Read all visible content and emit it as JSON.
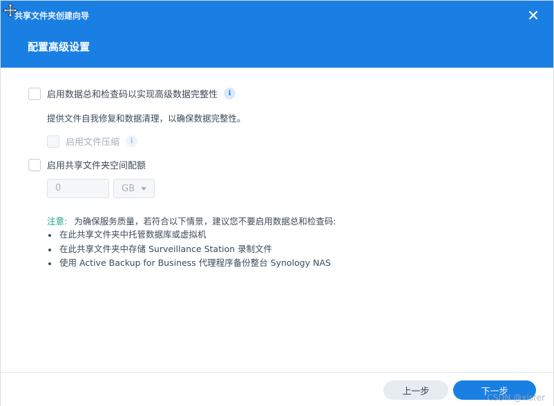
{
  "window": {
    "title": "共享文件夹创建向导",
    "step_title": "配置高级设置",
    "close_icon": "close-icon",
    "move_icon": "move-icon"
  },
  "options": {
    "checksum": {
      "label": "启用数据总和检查码以实现高级数据完整性",
      "checked": false
    },
    "checksum_desc": "提供文件自我修复和数据清理，以确保数据完整性。",
    "compression": {
      "label": "启用文件压缩",
      "checked": false,
      "disabled": true
    },
    "quota": {
      "label": "启用共享文件夹空间配额",
      "checked": false
    }
  },
  "quota_input": {
    "value": "0",
    "unit": "GB"
  },
  "note": {
    "label": "注意:",
    "text": "为确保服务质量，若符合以下情景，建议您不要启用数据总和检查码:",
    "items": [
      "在此共享文件夹中托管数据库或虚拟机",
      "在此共享文件夹中存储 Surveillance Station 录制文件",
      "使用 Active Backup for Business 代理程序备份整台 Synology NAS"
    ]
  },
  "footer": {
    "prev_label": "上一步",
    "next_label": "下一步"
  },
  "watermark": "CSDN @xister",
  "colors": {
    "accent": "#1a7fe3",
    "note": "#15a08a"
  }
}
